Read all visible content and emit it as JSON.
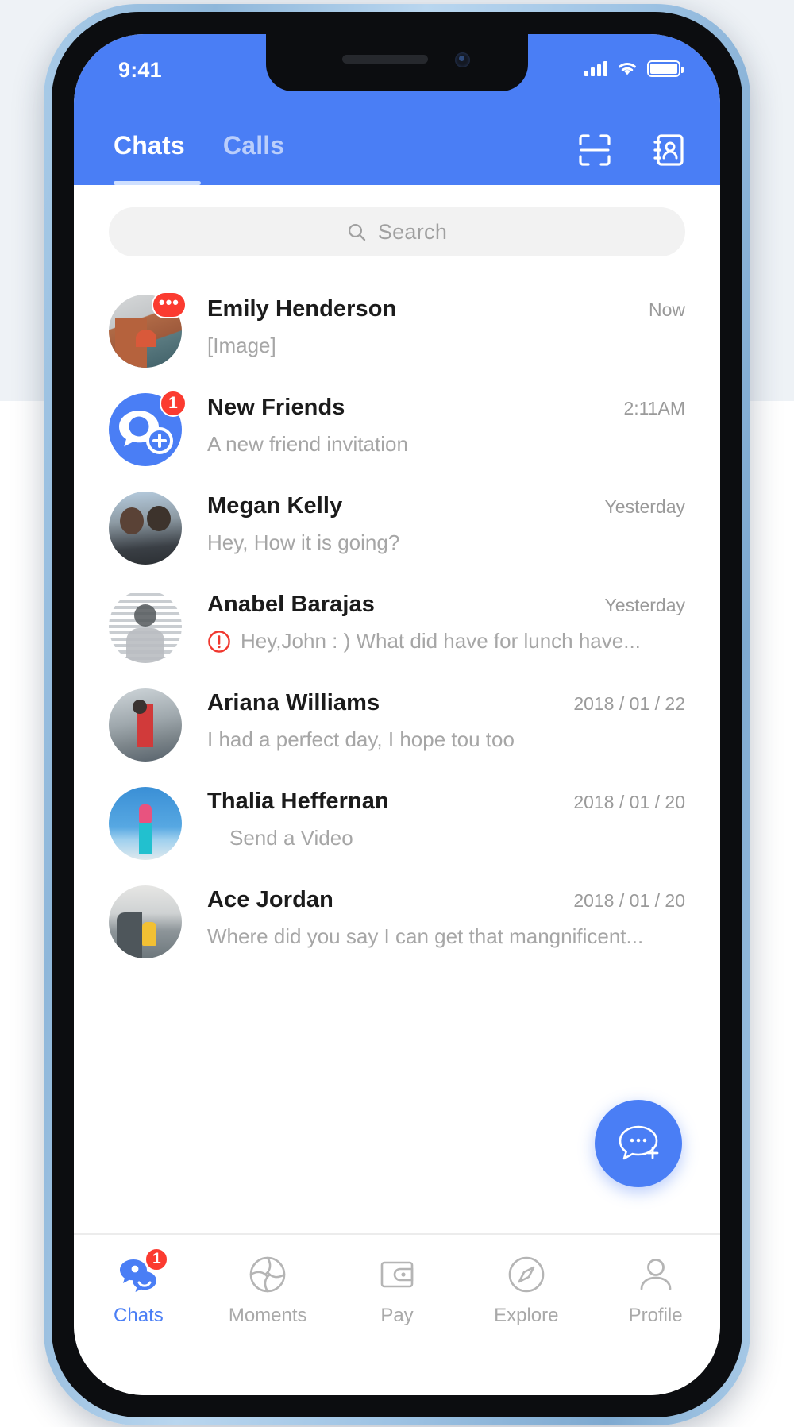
{
  "status_bar": {
    "time": "9:41",
    "signal_icon": "cellular-signal-icon",
    "wifi_icon": "wifi-icon",
    "battery_icon": "battery-icon"
  },
  "header": {
    "tabs": [
      {
        "label": "Chats",
        "active": true
      },
      {
        "label": "Calls",
        "active": false
      }
    ],
    "actions": [
      {
        "name": "scan-qr-icon"
      },
      {
        "name": "contacts-icon"
      }
    ],
    "accent_color": "#4a7ef5"
  },
  "search": {
    "placeholder": "Search",
    "value": "",
    "icon": "search-icon"
  },
  "chats": [
    {
      "name": "Emily Henderson",
      "preview": "[Image]",
      "time": "Now",
      "badge": "•••",
      "badge_kind": "dots",
      "avatar": "av-emily",
      "has_warning": false,
      "indent": false
    },
    {
      "name": "New Friends",
      "preview": "A new friend invitation",
      "time": "2:11AM",
      "badge": "1",
      "badge_kind": "count",
      "avatar": "av-newfriends",
      "has_warning": false,
      "indent": false
    },
    {
      "name": "Megan Kelly",
      "preview": "Hey, How it is going?",
      "time": "Yesterday",
      "badge": "",
      "badge_kind": "none",
      "avatar": "av-megan",
      "has_warning": false,
      "indent": false
    },
    {
      "name": "Anabel Barajas",
      "preview": "Hey,John : )   What did have for lunch have...",
      "time": "Yesterday",
      "badge": "",
      "badge_kind": "none",
      "avatar": "av-anabel",
      "has_warning": true,
      "indent": false
    },
    {
      "name": "Ariana Williams",
      "preview": "I had a perfect day, I hope tou too",
      "time": "2018 / 01 / 22",
      "badge": "",
      "badge_kind": "none",
      "avatar": "av-ariana",
      "has_warning": false,
      "indent": false
    },
    {
      "name": "Thalia Heffernan",
      "preview": "Send a Video",
      "time": "2018 / 01 / 20",
      "badge": "",
      "badge_kind": "none",
      "avatar": "av-thalia",
      "has_warning": false,
      "indent": true
    },
    {
      "name": "Ace Jordan",
      "preview": "Where did you say I can get that mangnificent...",
      "time": "2018 / 01 / 20",
      "badge": "",
      "badge_kind": "none",
      "avatar": "av-ace",
      "has_warning": false,
      "indent": false
    }
  ],
  "fab": {
    "name": "new-chat-fab",
    "icon": "chat-bubble-plus-icon",
    "color": "#4a7ef5"
  },
  "tabbar": [
    {
      "label": "Chats",
      "icon": "chats-icon",
      "active": true,
      "badge": "1"
    },
    {
      "label": "Moments",
      "icon": "moments-icon",
      "active": false,
      "badge": ""
    },
    {
      "label": "Pay",
      "icon": "pay-icon",
      "active": false,
      "badge": ""
    },
    {
      "label": "Explore",
      "icon": "explore-icon",
      "active": false,
      "badge": ""
    },
    {
      "label": "Profile",
      "icon": "profile-icon",
      "active": false,
      "badge": ""
    }
  ],
  "colors": {
    "accent": "#4a7ef5",
    "badge_red": "#fb3b30",
    "warning_red": "#f0382f",
    "text_primary": "#1b1b1b",
    "text_secondary": "#a6a6a6"
  }
}
